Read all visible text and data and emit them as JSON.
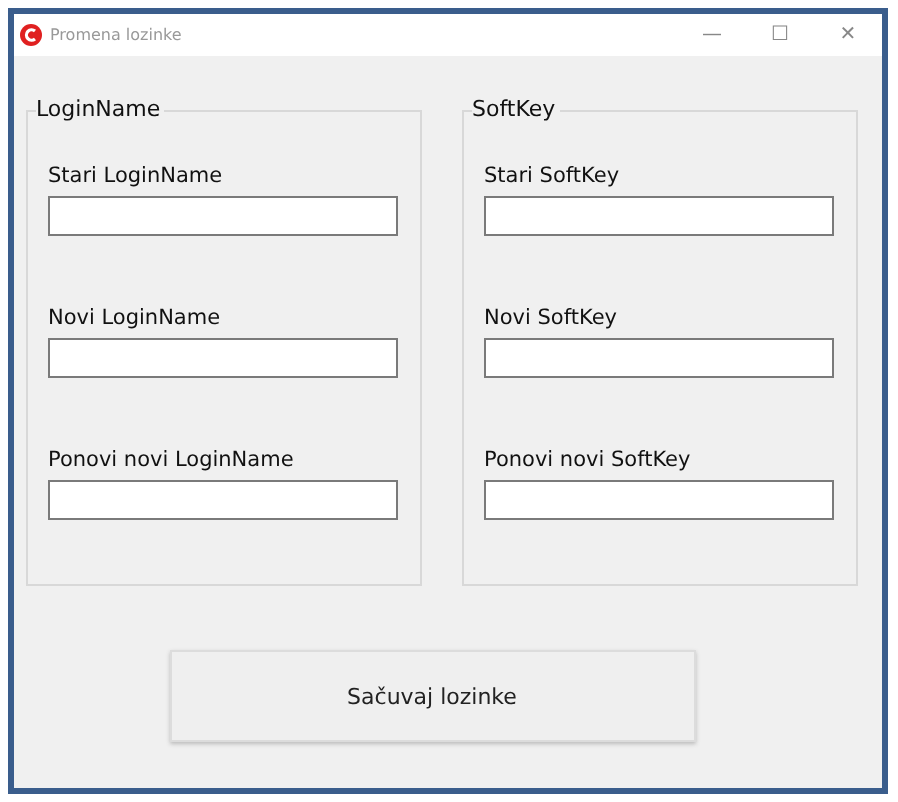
{
  "window": {
    "title": "Promena lozinke",
    "controls": [
      "—",
      "☐",
      "✕"
    ]
  },
  "groups": [
    {
      "title": "LoginName",
      "fields": [
        {
          "label": "Stari LoginName"
        },
        {
          "label": "Novi LoginName"
        },
        {
          "label": "Ponovi novi LoginName"
        }
      ]
    },
    {
      "title": "SoftKey",
      "fields": [
        {
          "label": "Stari SoftKey"
        },
        {
          "label": "Novi SoftKey"
        },
        {
          "label": "Ponovi novi SoftKey"
        }
      ]
    }
  ],
  "button": "Sačuvaj lozinke"
}
